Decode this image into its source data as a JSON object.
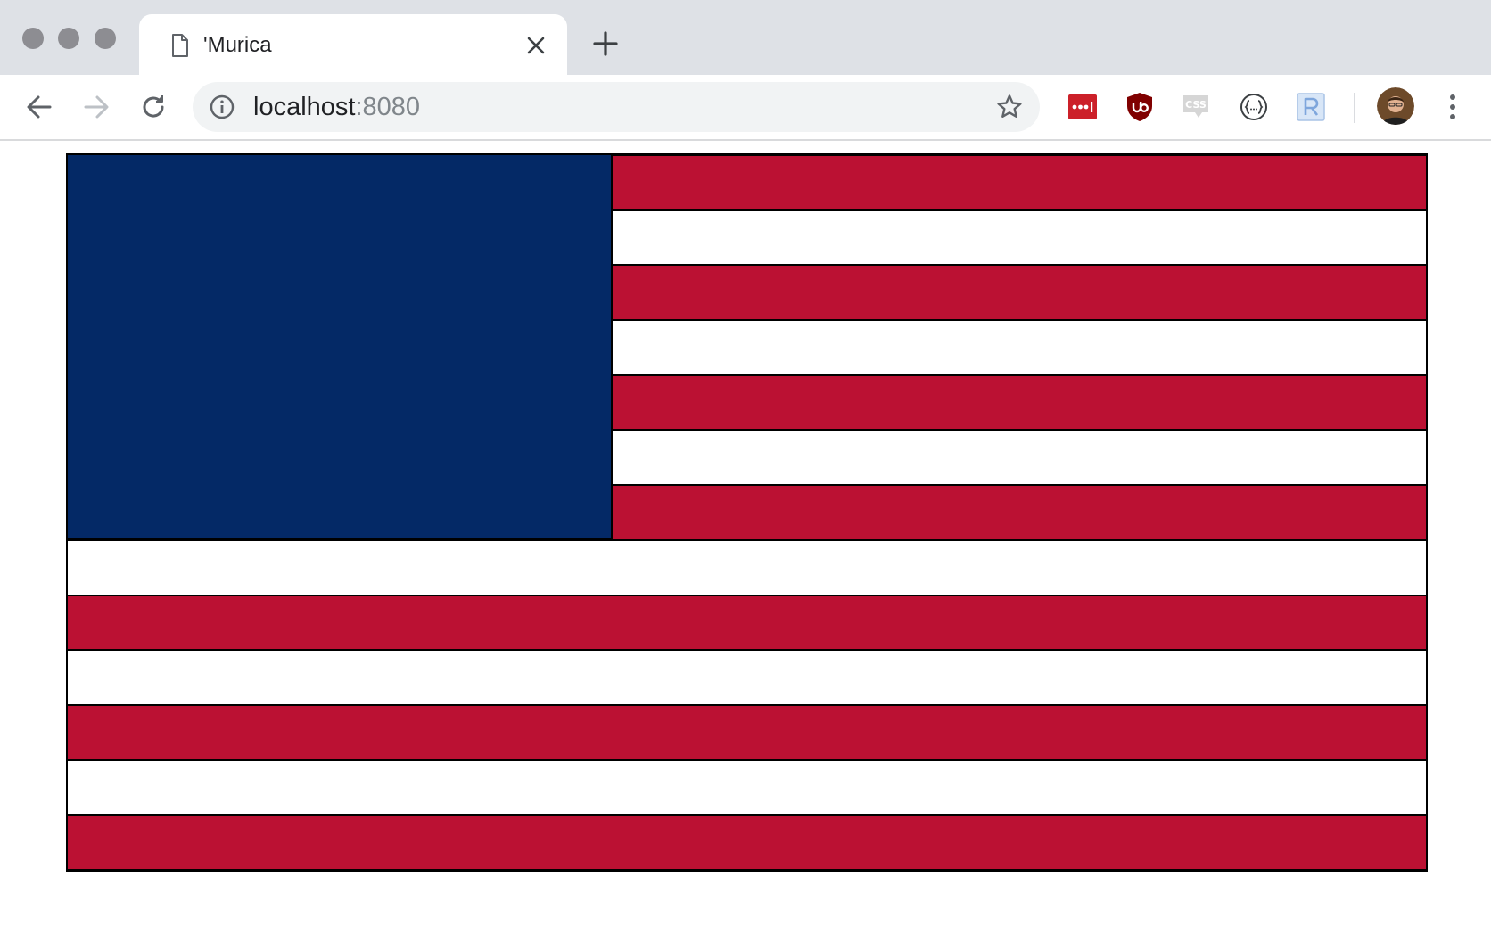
{
  "browser": {
    "tab": {
      "title": "'Murica",
      "favicon": "document-icon"
    },
    "address": {
      "host": "localhost",
      "port": ":8080"
    },
    "extensions": [
      "lastpass-icon",
      "ublock-icon",
      "css-viewer-icon",
      "json-viewer-icon",
      "r-extension-icon"
    ]
  },
  "flag": {
    "colors": {
      "red": "#bb1133",
      "white": "#ffffff",
      "blue": "#042966",
      "outline": "#000000"
    },
    "stripe_count": 13,
    "stripes": [
      "red",
      "white",
      "red",
      "white",
      "red",
      "white",
      "red",
      "white",
      "red",
      "white",
      "red",
      "white",
      "red"
    ],
    "canton_stripe_span": 7,
    "canton_color": "blue"
  }
}
